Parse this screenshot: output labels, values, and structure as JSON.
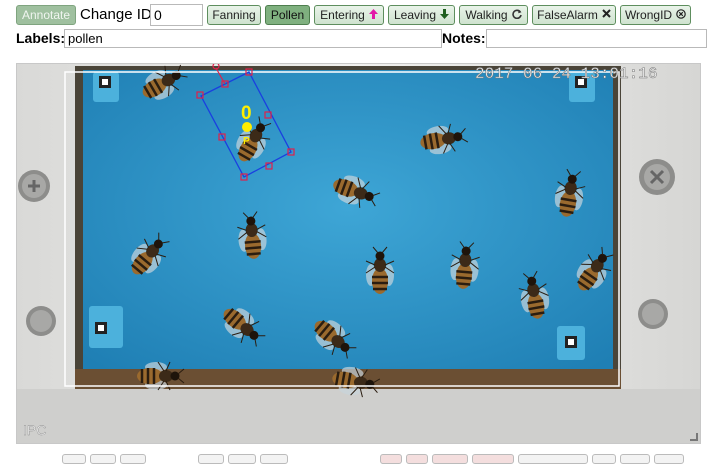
{
  "toolbar": {
    "annotate_label": "Annotate",
    "change_id_label": "Change ID",
    "change_id_value": "0",
    "fanning_label": "Fanning",
    "pollen_label": "Pollen",
    "entering_label": "Entering",
    "leaving_label": "Leaving",
    "walking_label": "Walking",
    "falsealarm_label": "FalseAlarm",
    "wrongid_label": "WrongID"
  },
  "labels_row": {
    "labels_label": "Labels:",
    "labels_value": "pollen",
    "notes_label": "Notes:",
    "notes_value": ""
  },
  "video": {
    "timestamp": "2017 06 24 13:01:16",
    "watermark": "IPC",
    "selected_bee_id": "0",
    "selected_bee_tag": "P"
  },
  "colors": {
    "button_green": "#cfe3cf",
    "active_green": "#7fb07f",
    "arena_blue": "#2f95c7",
    "bbox_blue": "#1a3fe0",
    "bbox_red": "#e0204a",
    "id_yellow": "#ffee00",
    "entering_icon": "#e21aa8"
  },
  "icons": {
    "entering": "arrow-up-icon",
    "leaving": "arrow-down-icon",
    "walking": "refresh-icon",
    "falsealarm": "x-mark-icon",
    "wrongid": "circle-x-icon"
  }
}
